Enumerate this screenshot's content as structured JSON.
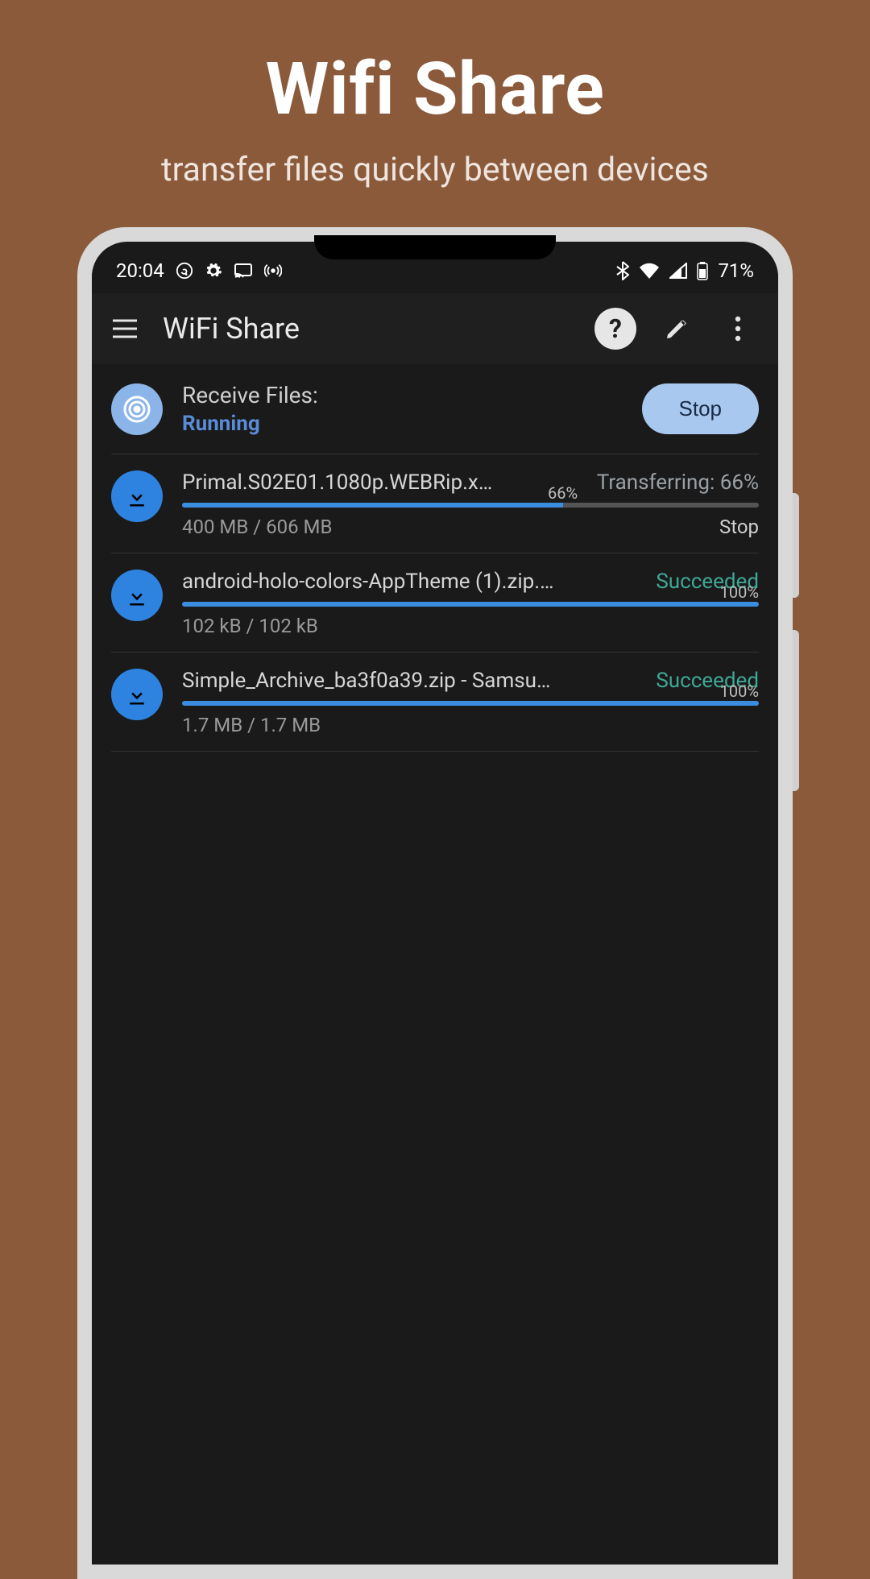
{
  "promo": {
    "title": "Wifi Share",
    "subtitle": "transfer files quickly between devices"
  },
  "status_bar": {
    "time": "20:04",
    "battery": "71%"
  },
  "app_bar": {
    "title": "WiFi Share",
    "help_glyph": "?"
  },
  "header": {
    "label": "Receive Files:",
    "status": "Running",
    "stop_label": "Stop"
  },
  "transfers": [
    {
      "filename": "Primal.S02E01.1080p.WEBRip.x…",
      "state_text": "Transferring: 66%",
      "state_kind": "transfer",
      "progress_percent": 66,
      "progress_label": "66%",
      "size_text": "400 MB / 606 MB",
      "action_label": "Stop"
    },
    {
      "filename": "android-holo-colors-AppTheme (1).zip.…",
      "state_text": "Succeeded",
      "state_kind": "success",
      "progress_percent": 100,
      "progress_label": "100%",
      "size_text": "102 kB / 102 kB",
      "action_label": ""
    },
    {
      "filename": "Simple_Archive_ba3f0a39.zip - Samsu…",
      "state_text": "Succeeded",
      "state_kind": "success",
      "progress_percent": 100,
      "progress_label": "100%",
      "size_text": "1.7 MB / 1.7 MB",
      "action_label": ""
    }
  ]
}
